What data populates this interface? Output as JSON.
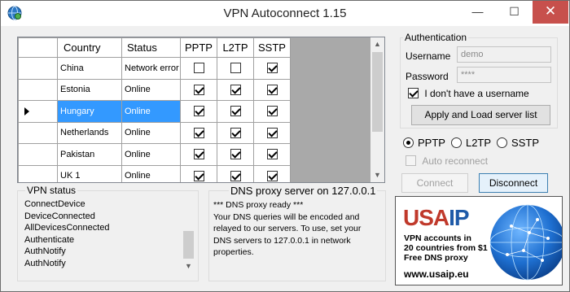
{
  "window": {
    "title": "VPN Autoconnect 1.15",
    "minimize": "—",
    "maximize": "☐",
    "close": "✕"
  },
  "grid": {
    "columns": [
      "",
      "Country",
      "Status",
      "PPTP",
      "L2TP",
      "SSTP"
    ],
    "rows": [
      {
        "country": "China",
        "status": "Network error",
        "pptp": false,
        "l2tp": false,
        "sstp": true,
        "selected": false
      },
      {
        "country": "Estonia",
        "status": "Online",
        "pptp": true,
        "l2tp": true,
        "sstp": true,
        "selected": false
      },
      {
        "country": "Hungary",
        "status": "Online",
        "pptp": true,
        "l2tp": true,
        "sstp": true,
        "selected": true
      },
      {
        "country": "Netherlands",
        "status": "Online",
        "pptp": true,
        "l2tp": true,
        "sstp": true,
        "selected": false
      },
      {
        "country": "Pakistan",
        "status": "Online",
        "pptp": true,
        "l2tp": true,
        "sstp": true,
        "selected": false
      },
      {
        "country": "UK 1",
        "status": "Online",
        "pptp": true,
        "l2tp": true,
        "sstp": true,
        "selected": false
      }
    ],
    "scroll_up": "▲",
    "scroll_down": "▼"
  },
  "auth": {
    "title": "Authentication",
    "username_label": "Username",
    "username_value": "demo",
    "password_label": "Password",
    "password_value": "****",
    "no_username_label": "I don't have a username",
    "no_username_checked": true,
    "apply_button": "Apply and Load server list"
  },
  "protocol": {
    "options": [
      "PPTP",
      "L2TP",
      "SSTP"
    ],
    "selected": "PPTP",
    "auto_reconnect_label": "Auto reconnect",
    "auto_reconnect_checked": false
  },
  "actions": {
    "connect": "Connect",
    "disconnect": "Disconnect"
  },
  "vpn_status": {
    "title": "VPN status",
    "lines": [
      "ConnectDevice",
      "DeviceConnected",
      "AllDevicesConnected",
      "Authenticate",
      "AuthNotify",
      "AuthNotify"
    ]
  },
  "dns": {
    "title": "DNS proxy server on 127.0.0.1",
    "lines": [
      "*** DNS proxy ready ***",
      "Your DNS queries will be encoded and",
      "relayed to our servers. To use, set your",
      "DNS servers to 127.0.0.1 in network",
      "properties."
    ]
  },
  "ad": {
    "brand_a": "USA",
    "brand_b": "IP",
    "lines": [
      "VPN accounts in",
      "20 countries from $1",
      "Free DNS proxy"
    ],
    "url": "www.usaip.eu",
    "colors": {
      "usa": "#c0392b",
      "ip": "#1e5aa8",
      "globe": "#1565c0"
    }
  }
}
